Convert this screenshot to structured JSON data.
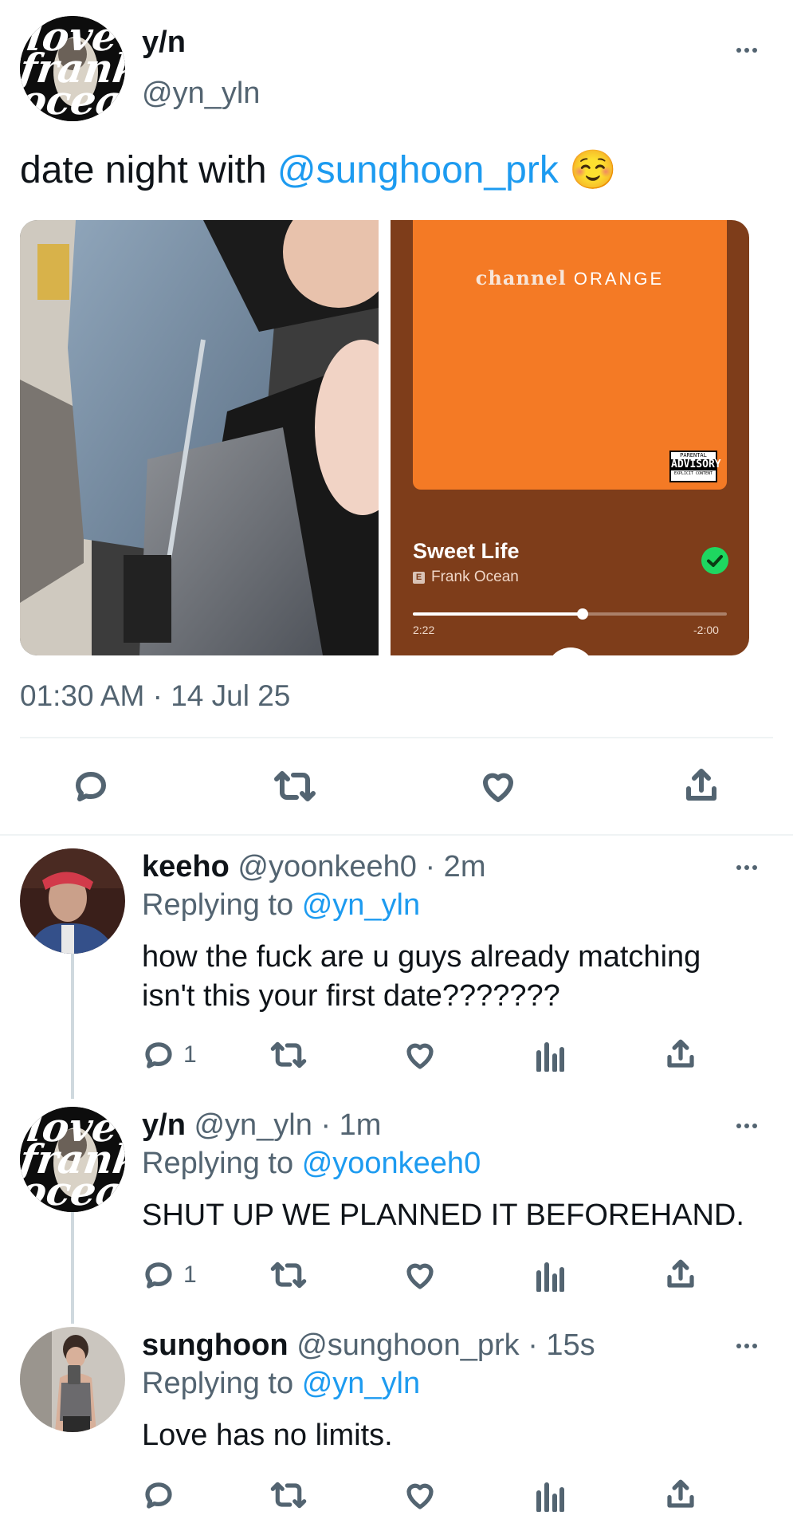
{
  "main_tweet": {
    "display_name": "y/n",
    "handle": "@yn_yln",
    "text_prefix": "date night with ",
    "mention": "@sunghoon_prk",
    "emoji": "☺️",
    "timestamp": "01:30 AM · 14 Jul 25",
    "avatar_text": [
      "love",
      "frank",
      "ocean"
    ]
  },
  "music_card": {
    "album_title_a": "channel",
    "album_title_b": "ORANGE",
    "advisory": [
      "PARENTAL",
      "ADVISORY",
      "EXPLICIT CONTENT"
    ],
    "track": "Sweet Life",
    "explicit": "E",
    "artist": "Frank Ocean",
    "elapsed": "2:22",
    "remaining": "-2:00",
    "progress": 0.54,
    "colors": {
      "background": "#7e3d1a",
      "album": "#f47a25",
      "check": "#1ed760"
    }
  },
  "replies": [
    {
      "display_name": "keeho",
      "handle": "@yoonkeeh0",
      "time": "· 2m",
      "replying_prefix": "Replying to",
      "replying_to": "@yn_yln",
      "text_lines": [
        "how the fuck are u guys already matching",
        "isn't this your first date???????"
      ],
      "reply_count": "1"
    },
    {
      "display_name": "y/n",
      "handle": "@yn_yln",
      "time": "· 1m",
      "replying_prefix": "Replying to",
      "replying_to": "@yoonkeeh0",
      "text_lines": [
        "SHUT UP WE PLANNED IT BEFOREHAND."
      ],
      "reply_count": "1"
    },
    {
      "display_name": "sunghoon",
      "handle": "@sunghoon_prk",
      "time": "· 15s",
      "replying_prefix": "Replying to",
      "replying_to": "@yn_yln",
      "text_lines": [
        "Love has no limits."
      ],
      "reply_count": ""
    }
  ],
  "colors": {
    "link": "#1d9bf0",
    "muted": "#536471",
    "divider": "#eff3f4"
  }
}
